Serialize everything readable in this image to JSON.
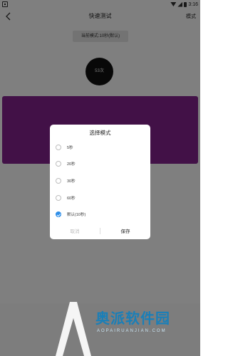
{
  "statusbar": {
    "time": "3:16"
  },
  "toolbar": {
    "title": "快速测试",
    "mode_label": "模式"
  },
  "current_mode": "当前模式:10秒(默认)",
  "counter": "53次",
  "dialog": {
    "title": "选择模式",
    "options": [
      {
        "label": "5秒",
        "selected": false
      },
      {
        "label": "20秒",
        "selected": false
      },
      {
        "label": "30秒",
        "selected": false
      },
      {
        "label": "60秒",
        "selected": false
      },
      {
        "label": "默认(10秒)",
        "selected": true
      }
    ],
    "cancel": "取消",
    "save": "保存"
  },
  "watermark": {
    "text": "奥派软件园",
    "domain": "AOPAIRUANJIAN.COM"
  },
  "colors": {
    "accent_purple": "#84238f",
    "checkbox_blue": "#2e8ee8",
    "overlay": "rgba(0,0,0,0.5)",
    "watermark_blue": "#1a7fb8"
  }
}
